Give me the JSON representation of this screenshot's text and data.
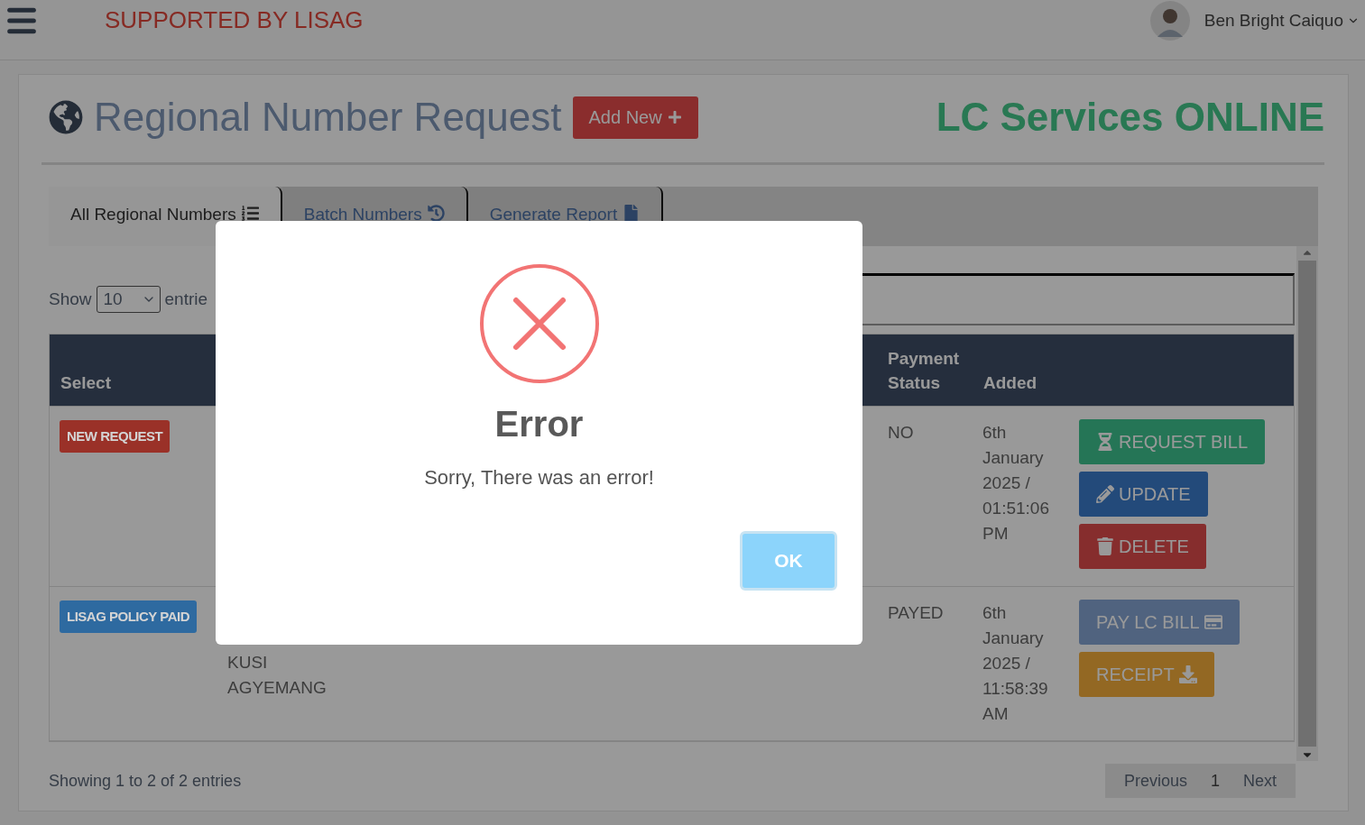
{
  "topbar": {
    "brand": "SUPPORTED BY LISAG",
    "user": "Ben Bright Caiquo"
  },
  "header": {
    "title": "Regional Number Request",
    "add_button": "Add New",
    "site_name": "LC Services ONLINE"
  },
  "tabs": [
    {
      "label": "All Regional Numbers",
      "kind": "list",
      "selected": true
    },
    {
      "label": "Batch Numbers",
      "kind": "history",
      "selected": false
    },
    {
      "label": "Generate Report",
      "kind": "file",
      "selected": false
    }
  ],
  "length": {
    "show": "Show",
    "value": "10",
    "entries": "entrie"
  },
  "table": {
    "columns": [
      "Select",
      "Payment Status",
      "Added"
    ],
    "rows": [
      {
        "badge": {
          "label": "NEW REQUEST",
          "color": "#9a3128"
        },
        "column_2": "",
        "payment_status": "NO",
        "added": "6th January 2025 / 01:51:06 PM",
        "actions": [
          {
            "label": "REQUEST BILL",
            "kind": "success"
          },
          {
            "label": "UPDATE",
            "kind": "primary"
          },
          {
            "label": "DELETE",
            "kind": "danger"
          }
        ]
      },
      {
        "badge": {
          "label": "LISAG POLICY PAID",
          "color": "#2e6aa0"
        },
        "column_2": "KUSI AGYEMANG",
        "payment_status": "PAYED",
        "added": "6th January 2025 / 11:58:39 AM",
        "actions": [
          {
            "label": "PAY LC BILL",
            "kind": "info"
          },
          {
            "label": "RECEIPT",
            "kind": "warning"
          }
        ]
      }
    ]
  },
  "footer": {
    "info": "Showing 1 to 2 of 2 entries",
    "pagination": [
      {
        "label": "Previous",
        "selected": false
      },
      {
        "label": "1",
        "selected": true
      },
      {
        "label": "Next",
        "selected": false
      }
    ]
  },
  "dialog": {
    "title": "Error",
    "message": "Sorry, There was an error!",
    "button": "OK"
  }
}
